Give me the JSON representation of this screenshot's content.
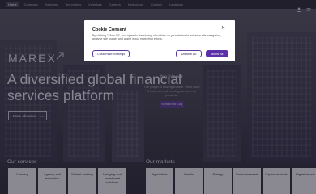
{
  "nav": {
    "items": [
      "Home",
      "Company",
      "Services",
      "Technology",
      "Investors",
      "Careers",
      "Newsroom",
      "Contact",
      "Locations"
    ],
    "active_index": 0
  },
  "hero": {
    "logo_text": "MAREX",
    "headline": "A diversified global financial services platform",
    "cta_label": "More about us",
    "cta_arrow": "→"
  },
  "video": {
    "title": "No player",
    "subtitle": "The player is having trouble. We'll have it back up and running as soon as possible.",
    "button_label": "Send Error Log"
  },
  "services": {
    "title": "Our services",
    "items": [
      "Clearing",
      "Agency and execution",
      "Market making",
      "Hedging and investment solutions"
    ]
  },
  "markets": {
    "title": "Our markets",
    "items": [
      "Agriculture",
      "Metals",
      "Energy",
      "Environmentals",
      "Capital markets",
      "Digital assets"
    ]
  },
  "cookie": {
    "title": "Cookie Consent",
    "text": "By clicking \"Allow All\", you agree to the storing of cookies on your device to enhance site navigation, analyse site usage, and assist in our marketing efforts.",
    "settings_label": "Customise Settings",
    "disable_label": "Disable All",
    "allow_label": "Allow All",
    "close_label": "✕"
  },
  "colors": {
    "accent": "#5a2fa8",
    "nav_bg": "#2c2a38"
  }
}
